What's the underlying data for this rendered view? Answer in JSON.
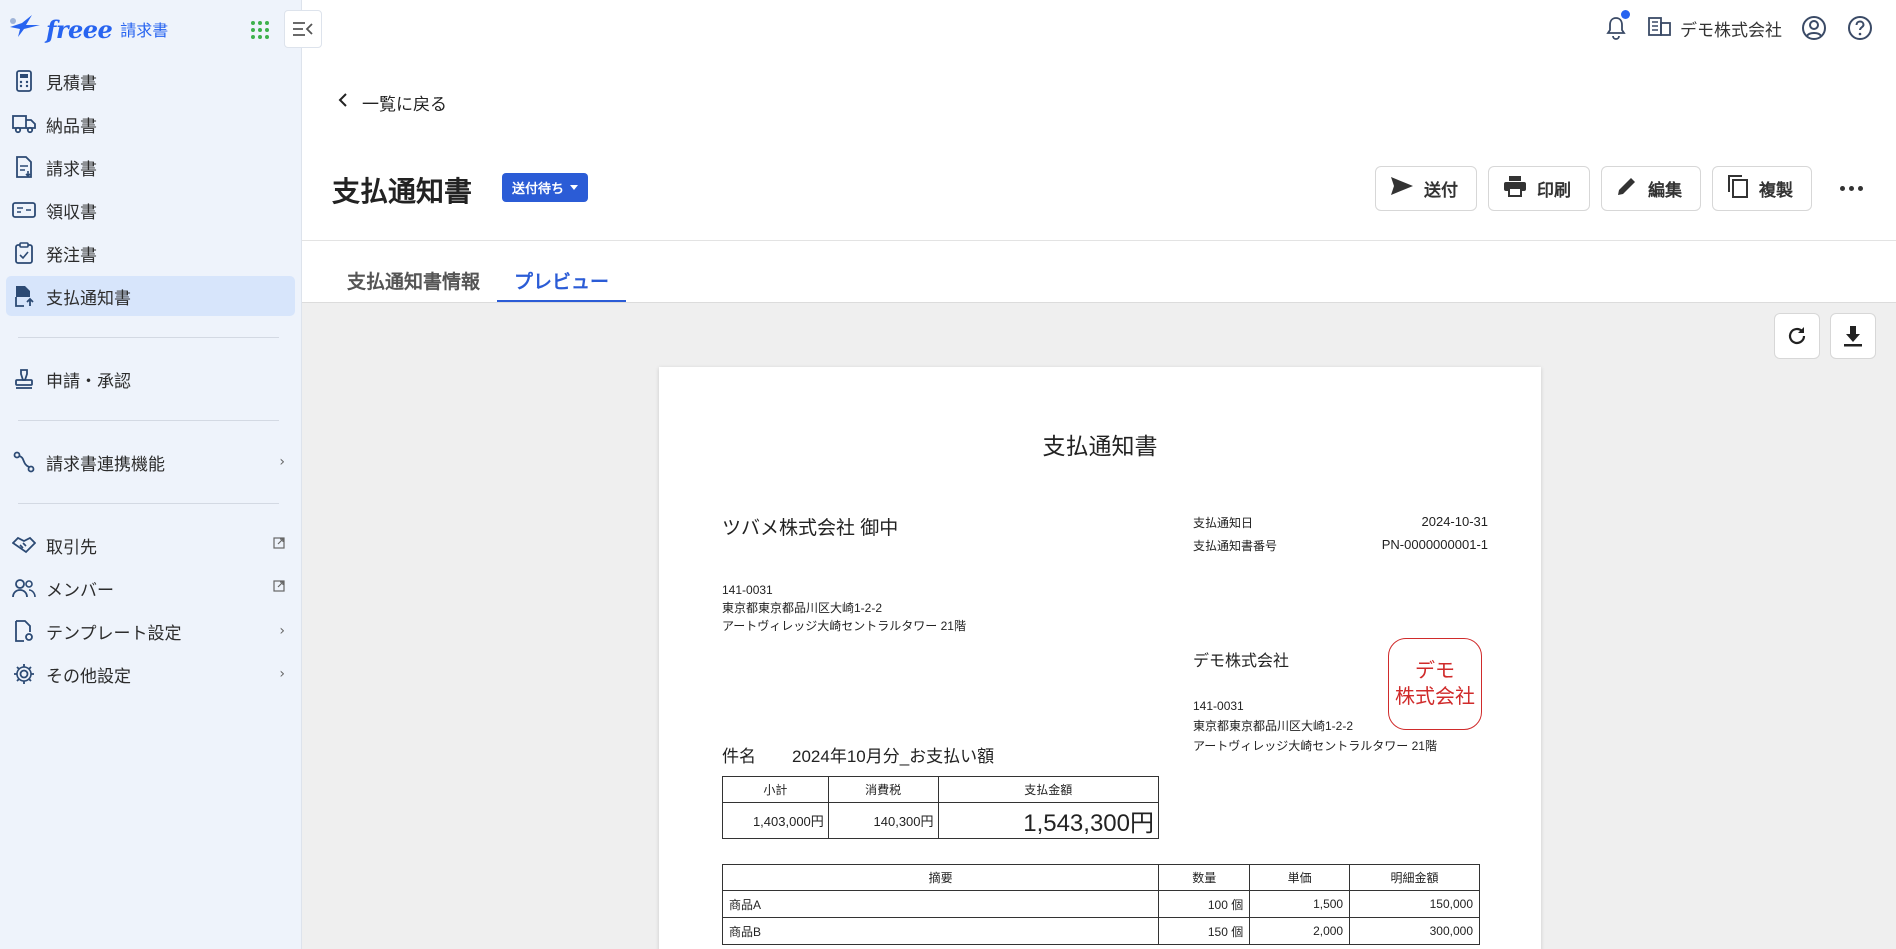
{
  "app": {
    "brand": "freee",
    "product": "請求書"
  },
  "sidebar": {
    "items": [
      {
        "label": "見積書",
        "icon": "calculator-icon"
      },
      {
        "label": "納品書",
        "icon": "truck-icon"
      },
      {
        "label": "請求書",
        "icon": "invoice-icon"
      },
      {
        "label": "領収書",
        "icon": "receipt-icon"
      },
      {
        "label": "発注書",
        "icon": "clipboard-icon"
      },
      {
        "label": "支払通知書",
        "icon": "payment-notice-icon",
        "active": true
      }
    ],
    "group2": [
      {
        "label": "申請・承認",
        "icon": "stamp-icon"
      }
    ],
    "group3": [
      {
        "label": "請求書連携機能",
        "icon": "integration-icon"
      }
    ],
    "group4": [
      {
        "label": "取引先",
        "icon": "handshake-icon"
      },
      {
        "label": "メンバー",
        "icon": "members-icon"
      },
      {
        "label": "テンプレート設定",
        "icon": "template-settings-icon"
      },
      {
        "label": "その他設定",
        "icon": "gear-icon"
      }
    ]
  },
  "topbar": {
    "company": "デモ株式会社"
  },
  "header": {
    "back_label": "一覧に戻る",
    "title": "支払通知書",
    "status": "送付待ち",
    "actions": {
      "send": "送付",
      "print": "印刷",
      "edit": "編集",
      "duplicate": "複製"
    }
  },
  "tabs": {
    "info": "支払通知書情報",
    "preview": "プレビュー"
  },
  "document": {
    "title": "支払通知書",
    "recipient": "ツバメ株式会社 御中",
    "recipient_address": {
      "zip": "141-0031",
      "line1": "東京都東京都品川区大崎1-2-2",
      "line2": "アートヴィレッジ大崎セントラルタワー 21階"
    },
    "meta": {
      "date_label": "支払通知日",
      "date": "2024-10-31",
      "number_label": "支払通知書番号",
      "number": "PN-0000000001-1"
    },
    "issuer": "デモ株式会社",
    "issuer_address": {
      "zip": "141-0031",
      "line1": "東京都東京都品川区大崎1-2-2",
      "line2": "アートヴィレッジ大崎セントラルタワー 21階"
    },
    "seal": {
      "line1": "デモ",
      "line2": "株式会社"
    },
    "subject_label": "件名",
    "subject": "2024年10月分_お支払い額",
    "summary": {
      "subtotal_label": "小計",
      "tax_label": "消費税",
      "total_label": "支払金額",
      "subtotal": "1,403,000円",
      "tax": "140,300円",
      "total": "1,543,300円"
    },
    "items_headers": {
      "description": "摘要",
      "quantity": "数量",
      "unit_price": "単価",
      "amount": "明細金額"
    },
    "items": [
      {
        "description": "商品A",
        "quantity": "100 個",
        "unit_price": "1,500",
        "amount": "150,000"
      },
      {
        "description": "商品B",
        "quantity": "150 個",
        "unit_price": "2,000",
        "amount": "300,000"
      }
    ]
  }
}
